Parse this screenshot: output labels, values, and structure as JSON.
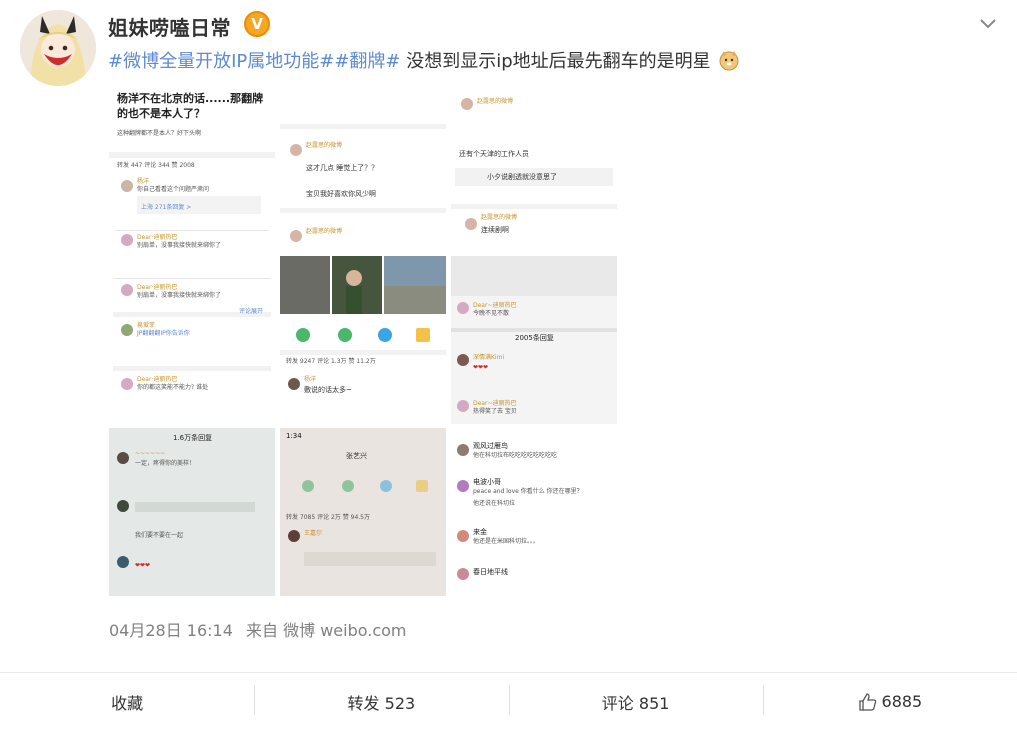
{
  "author": {
    "name": "姐妹唠嗑日常",
    "badge": "V"
  },
  "post": {
    "tags": [
      "#微博全量开放IP属地功能#",
      "#翻牌#"
    ],
    "text": "没想到显示ip地址后最先翻车的是明星",
    "emoji_icon": "doge-emoji-icon"
  },
  "thumbs": {
    "t1": {
      "title": "杨洋不在北京的话......那翻牌的也不是本人了？",
      "sub": "这种翻牌都不是本人？好下头啊",
      "tabs": "转发 447   评论 344                    赞 2008",
      "c1_name": "杨洋",
      "c1_text": "你自己看看这个问题严肃问",
      "c1_sub": "上海 271条回复 >",
      "c2_name": "Dear·迪丽热巴",
      "c2_text": "别扇单，没事我接快就来绑你了",
      "c3_name": "易爱菲",
      "c3_text": "JP翻翻翻IP你告诉你",
      "c4_name": "Dear·迪丽热巴",
      "c4_text": "你的都这笑能不能力? 谁处",
      "more": "评论展开"
    },
    "t2": {
      "c1_name": "赵露思的微博",
      "c1_text": "这才几点 睡觉上了？？",
      "c1_sub": "宝贝我好喜欢你风少啊",
      "c2_name": "赵露思的微博",
      "tabs": "转发 9247   评论 1.3万            赞 11.2万",
      "c3_name": "杨洋",
      "c3_text": "敷说的话太多~"
    },
    "t3": {
      "c1_name": "赵露思的微博",
      "t1": "还有个天津的工作人员",
      "t2": "小夕说剧透就没意思了",
      "c2_name": "赵露思的微博",
      "t3": "连续剧啊",
      "c3_name": "Dear~迪丽热巴",
      "t4": "今晚不见不散",
      "count": "2005条回复",
      "c4_name": "深情满Kimi",
      "c5_name": "Dear~迪丽热巴",
      "t5": "热得笑了去 宝贝"
    },
    "t4": {
      "title": "1.6万条回复",
      "c1": "一定，疼得你的美样！",
      "c3": "我们要不要在一起"
    },
    "t5": {
      "time": "1:34",
      "name": "张艺兴",
      "tabs": "转发 7085   评论 2万           赞 94.5万",
      "c1": "王嘉尔"
    },
    "t6": {
      "c1_name": "观风过雁鸟",
      "c1_text": "他在科切拉布吃吃吃吃吃吃吃吃",
      "c2_name": "电波小哥",
      "c2_text": "peace and love 你看什么 你还在哪里？",
      "c2_sub": "他还说在科切拉",
      "c3_name": "来金",
      "c3_text": "他还是在米国科切拉。。。",
      "c4_name": "春日地平线"
    }
  },
  "meta": {
    "time": "04月28日 16:14",
    "source": "来自 微博 weibo.com"
  },
  "footer": {
    "collect": "收藏",
    "repost": "转发 523",
    "comment": "评论 851",
    "like": "6885"
  }
}
